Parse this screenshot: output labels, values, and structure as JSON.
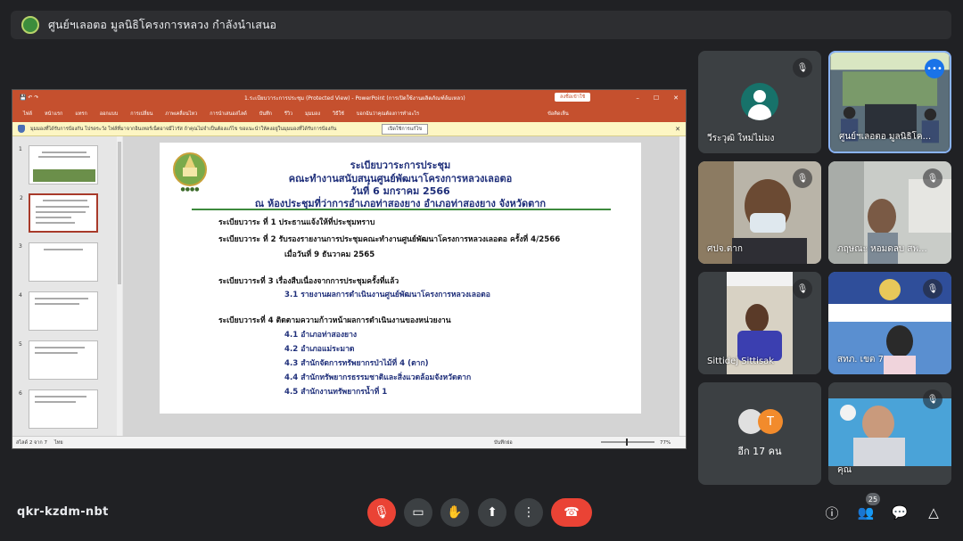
{
  "banner": {
    "text": "ศูนย์ฯเลอตอ มูลนิธิโครงการหลวง กำลังนำเสนอ"
  },
  "powerpoint": {
    "title": "1.ระเบียบวาระการประชุม (Protected View) - PowerPoint (การเปิดใช้งานผลิตภัณฑ์ล้มเหลว)",
    "signin": "ลงชื่อเข้าใช้",
    "ribbon_tabs": [
      "ไฟล์",
      "หน้าแรก",
      "แทรก",
      "ออกแบบ",
      "การเปลี่ยน",
      "ภาพเคลื่อนไหว",
      "การนำเสนอสไลด์",
      "บันทึก",
      "รีวิว",
      "มุมมอง",
      "วิธีใช้",
      "บอกฉันว่าคุณต้องการทำอะไร"
    ],
    "share": "ข้อคิดเห็น",
    "message": "มุมมองที่ได้รับการป้องกัน  โปรดระวัง ไฟล์ที่มาจากอินเทอร์เน็ตอาจมีไวรัส ถ้าคุณไม่จำเป็นต้องแก้ไข ขอแนะนำให้คงอยู่ในมุมมองที่ได้รับการป้องกัน",
    "enable_button": "เปิดใช้การแก้ไข",
    "thumb_numbers": [
      "1",
      "2",
      "3",
      "4",
      "5",
      "6"
    ],
    "status_left": "สไลด์ 2 จาก 7",
    "status_lang": "ไทย",
    "status_notes": "บันทึกย่อ",
    "zoom": "77%"
  },
  "slide": {
    "heading1": "ระเบียบวาระการประชุม",
    "heading2": "คณะทำงานสนับสนุนศูนย์พัฒนาโครงการหลวงเลอตอ",
    "heading3": "วันที่ 6 มกราคม 2566",
    "heading4": "ณ ห้องประชุมที่ว่าการอำเภอท่าสองยาง  อำเภอท่าสองยาง จังหวัดตาก",
    "items": [
      "ระเบียบวาระ ที่ 1  ประธานแจ้งให้ที่ประชุมทราบ",
      "ระเบียบวาระ ที่ 2  รับรองรายงานการประชุมคณะทำงานศูนย์พัฒนาโครงการหลวงเลอตอ ครั้งที่ 4/2566",
      "เมื่อวันที่  9 ธันวาคม 2565",
      "ระเบียบวาระที่  3  เรื่องสืบเนื่องจากการประชุมครั้งที่แล้ว",
      "3.1 รายงานผลการดำเนินงานศูนย์พัฒนาโครงการหลวงเลอตอ",
      "ระเบียบวาระที่  4  ติดตามความก้าวหน้าผลการดำเนินงานของหน่วยงาน",
      "4.1 อำเภอท่าสองยาง",
      "4.2 อำเภอแม่ระมาด",
      "4.3 สำนักจัดการทรัพยากรป่าไม้ที่ 4 (ตาก)",
      "4.4 สำนักทรัพยากรธรรมชาติและสิ่งแวดล้อมจังหวัดตาก",
      "4.5 สำนักงานทรัพยากรน้ำที่ 1"
    ]
  },
  "participants": [
    {
      "name": "วีระวุฒิ ใหม่ไม่มง"
    },
    {
      "name": "ศูนย์ฯเลอตอ มูลนิธิโค..."
    },
    {
      "name": "ศปจ.ตาก"
    },
    {
      "name": "ภฤษณะ หอมดลบ สพ..."
    },
    {
      "name": "Sittidej Sittisak"
    },
    {
      "name": "สทภ. เขต 7"
    },
    {
      "name": "อีก 17 คน",
      "avatar_letter": "T"
    },
    {
      "name": "คุณ"
    }
  ],
  "bottom": {
    "meeting_code": "qkr-kzdm-nbt",
    "people_count": "25"
  },
  "colors": {
    "accent": "#1a73e8",
    "leave": "#ea4335",
    "pp_red": "#c5502e"
  }
}
